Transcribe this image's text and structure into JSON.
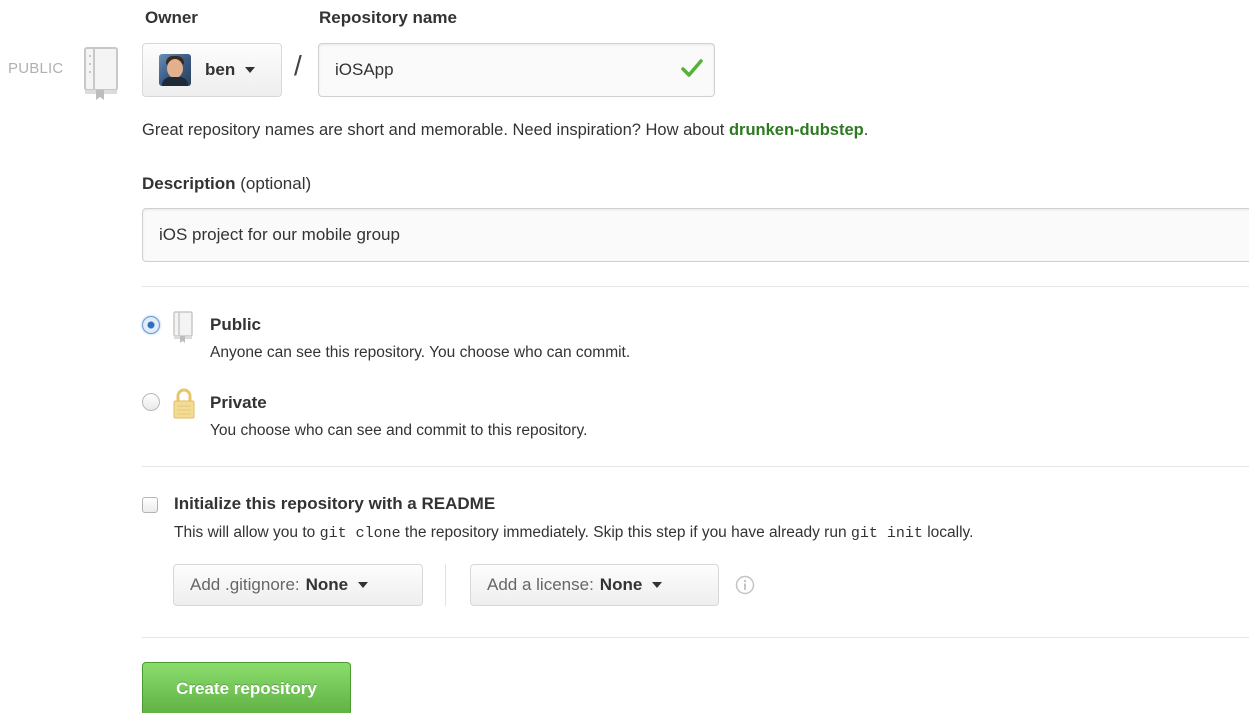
{
  "public_tag": "PUBLIC",
  "owner": {
    "label": "Owner",
    "selected": "ben"
  },
  "slash": "/",
  "repository": {
    "label": "Repository name",
    "value": "iOSApp"
  },
  "hint": {
    "text": "Great repository names are short and memorable. Need inspiration? How about ",
    "suggestion": "drunken-dubstep",
    "suffix": "."
  },
  "description": {
    "label": "Description",
    "optional": "(optional)",
    "value": "iOS project for our mobile group"
  },
  "visibility": {
    "selected": "public",
    "public": {
      "title": "Public",
      "desc": "Anyone can see this repository. You choose who can commit."
    },
    "private": {
      "title": "Private",
      "desc": "You choose who can see and commit to this repository."
    }
  },
  "readme": {
    "title": "Initialize this repository with a README",
    "checked": false,
    "desc_1": "This will allow you to ",
    "code_1": "git clone",
    "desc_2": " the repository immediately. Skip this step if you have already run ",
    "code_2": "git init",
    "desc_3": " locally."
  },
  "gitignore": {
    "label": "Add .gitignore:",
    "value": "None"
  },
  "license": {
    "label": "Add a license:",
    "value": "None"
  },
  "create_button": "Create repository",
  "colors": {
    "accent_green": "#60b044",
    "suggestion_green": "#2d7a21",
    "check_green": "#55b236",
    "lock_yellow": "#f0d58a"
  }
}
